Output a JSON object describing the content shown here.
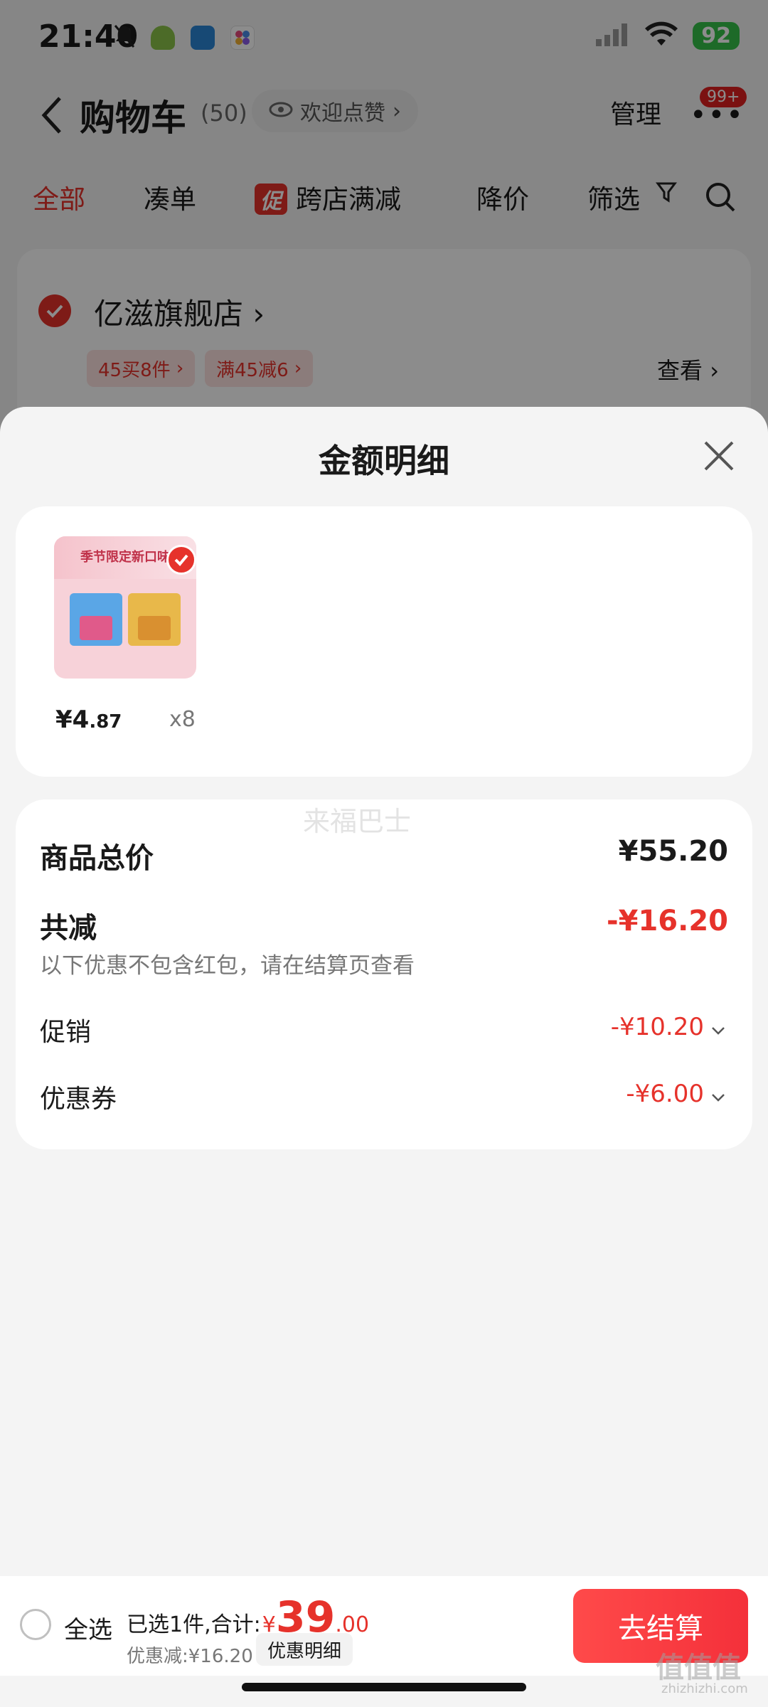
{
  "status_bar": {
    "time": "21:40",
    "battery": "92"
  },
  "header": {
    "title": "购物车",
    "count": "(50)",
    "like_label": "欢迎点赞",
    "manage_label": "管理",
    "more_badge": "99+"
  },
  "tabs": [
    {
      "label": "全部",
      "active": true
    },
    {
      "label": "凑单"
    },
    {
      "label": "跨店满减",
      "badge": "促"
    },
    {
      "label": "降价"
    },
    {
      "label": "筛选"
    }
  ],
  "store": {
    "name": "亿滋旗舰店",
    "chips": [
      "45买8件",
      "满45减6"
    ],
    "view_label": "查看"
  },
  "sheet": {
    "title": "金额明细",
    "product": {
      "thumb_banner": "季节限定新口味",
      "price_main": "¥4",
      "price_dec": ".87",
      "quantity": "x8"
    },
    "watermark": "来福巴士",
    "subtotal_label": "商品总价",
    "subtotal_value": "¥55.20",
    "reduction_label": "共减",
    "reduction_value": "-¥16.20",
    "reduction_note": "以下优惠不包含红包，请在结算页查看",
    "promo_label": "促销",
    "promo_value": "-¥10.20",
    "coupon_label": "优惠券",
    "coupon_value": "-¥6.00"
  },
  "bottom_bar": {
    "select_all_label": "全选",
    "selected_text": "已选1件,合计:",
    "currency": "¥",
    "total_int": "39",
    "total_dec": ".00",
    "discount_text": "优惠减:¥16.20",
    "detail_label": "优惠明细",
    "checkout_label": "去结算"
  },
  "corner_watermark": {
    "main": "值值值",
    "sub": "zhizhizhi.com"
  },
  "colors": {
    "accent": "#e6322b",
    "battery": "#35c24a"
  }
}
